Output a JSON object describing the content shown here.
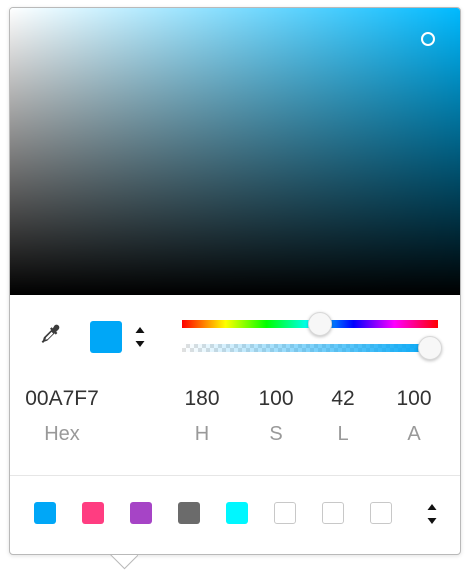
{
  "color": {
    "current_hex_color": "#00A7F7",
    "pure_hue_color": "#00BAFF",
    "alpha_fill_color": "#00A7F7"
  },
  "sliders": {
    "hue_percent": 54,
    "alpha_percent": 100
  },
  "values": {
    "hex": {
      "value": "00A7F7",
      "label": "Hex"
    },
    "h": {
      "value": "180",
      "label": "H"
    },
    "s": {
      "value": "100",
      "label": "S"
    },
    "l": {
      "value": "42",
      "label": "L"
    },
    "a": {
      "value": "100",
      "label": "A"
    }
  },
  "presets": [
    {
      "color": "#00A7F7",
      "empty": false
    },
    {
      "color": "#FF3D81",
      "empty": false
    },
    {
      "color": "#A644C6",
      "empty": false
    },
    {
      "color": "#6B6B6B",
      "empty": false
    },
    {
      "color": "#00F7FF",
      "empty": false
    },
    {
      "color": "",
      "empty": true
    },
    {
      "color": "",
      "empty": true
    },
    {
      "color": "",
      "empty": true
    }
  ],
  "icons": {
    "eyedropper": "eyedropper-icon",
    "swatch_toggle": "up-down-arrows-icon",
    "preset_toggle": "up-down-arrows-icon"
  }
}
